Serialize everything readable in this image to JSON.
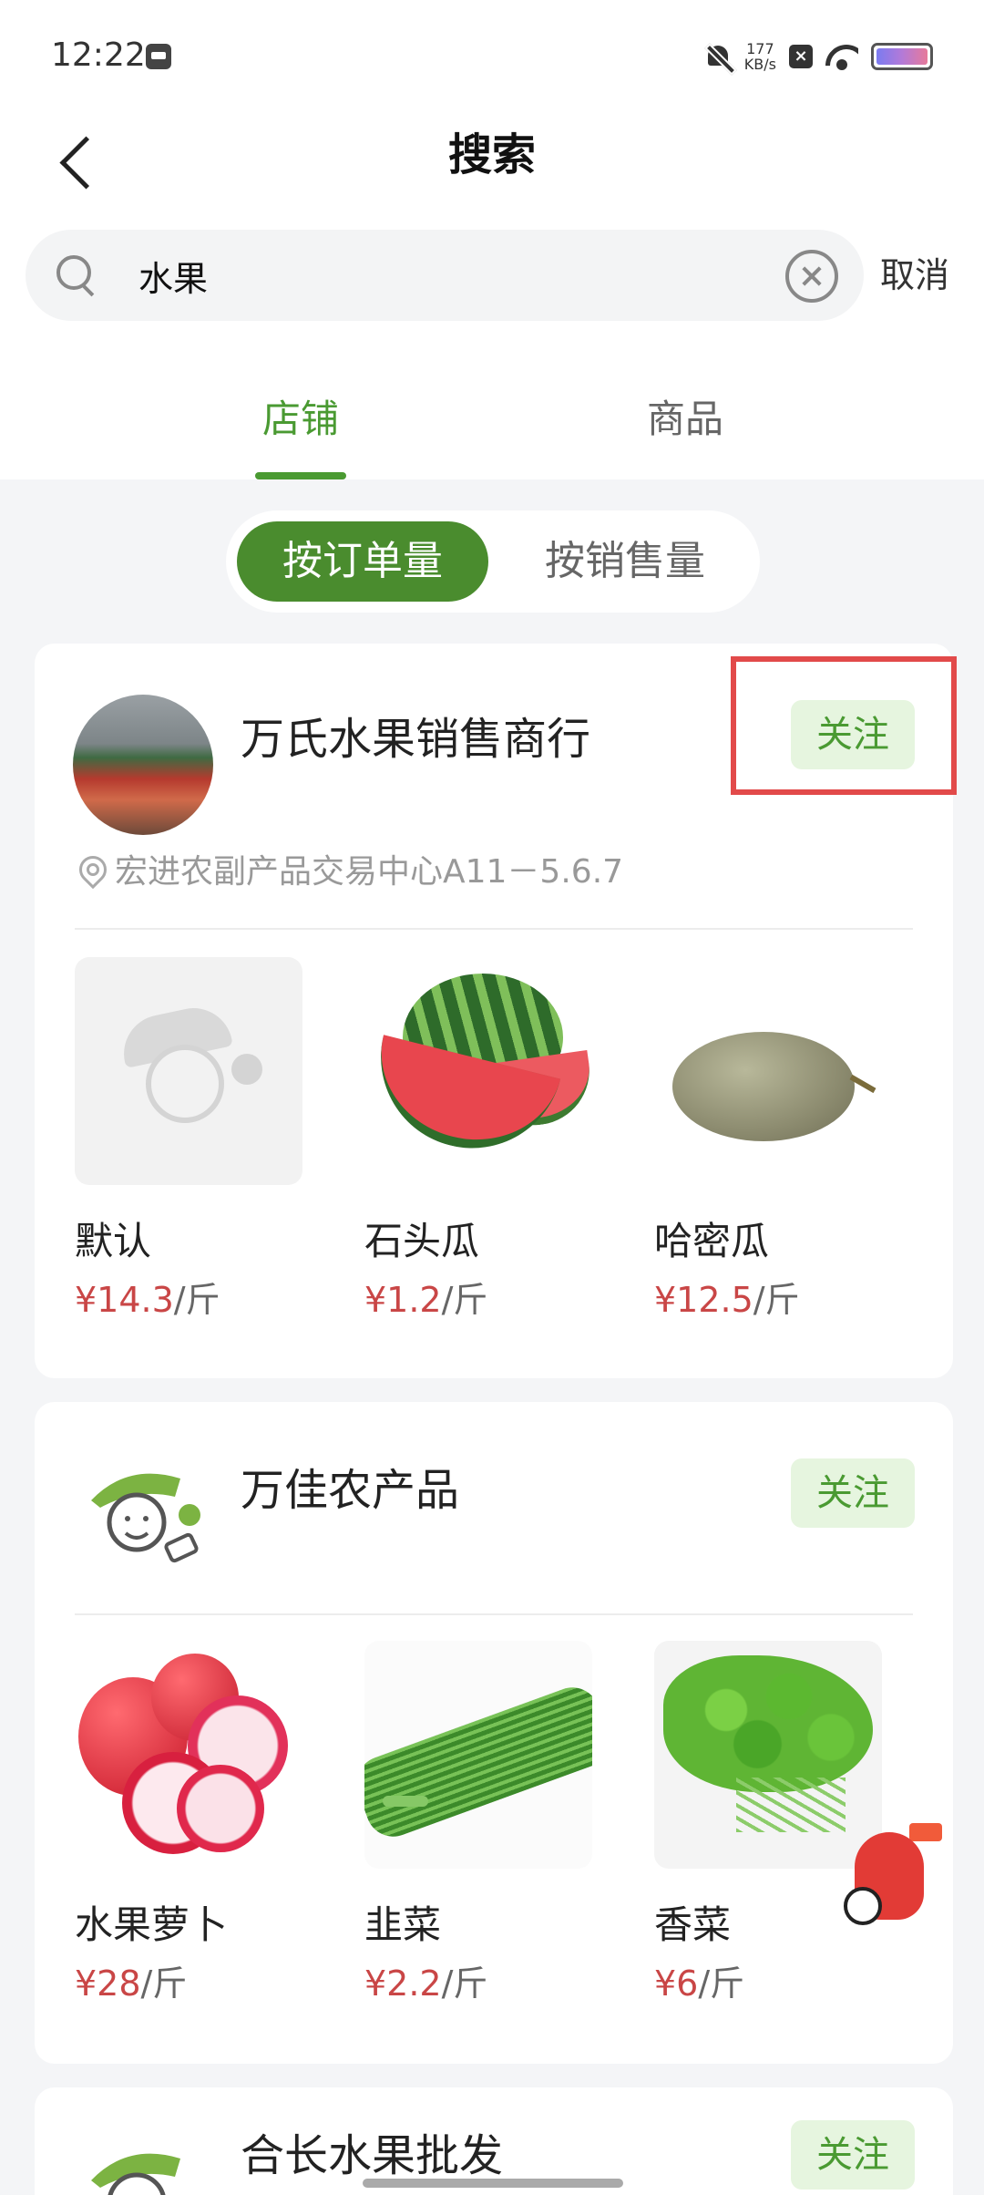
{
  "status_bar": {
    "time": "12:22",
    "net_speed_value": "177",
    "net_speed_unit": "KB/s"
  },
  "header": {
    "title": "搜索"
  },
  "search": {
    "query": "水果",
    "placeholder": "",
    "cancel_label": "取消"
  },
  "tabs": [
    {
      "label": "店铺",
      "active": true
    },
    {
      "label": "商品",
      "active": false
    }
  ],
  "sort": {
    "options": [
      {
        "label": "按订单量",
        "active": true
      },
      {
        "label": "按销售量",
        "active": false
      }
    ]
  },
  "colors": {
    "accent": "#4a9a32",
    "price": "#c94646",
    "highlight_box": "#e24a4a"
  },
  "stores": [
    {
      "name": "万氏水果销售商行",
      "follow_label": "关注",
      "address": "宏进农副产品交易中心A11－5.6.7",
      "products": [
        {
          "name": "默认",
          "price": "¥14.3",
          "unit": "/斤"
        },
        {
          "name": "石头瓜",
          "price": "¥1.2",
          "unit": "/斤"
        },
        {
          "name": "哈密瓜",
          "price": "¥12.5",
          "unit": "/斤"
        }
      ]
    },
    {
      "name": "万佳农产品",
      "follow_label": "关注",
      "products": [
        {
          "name": "水果萝卜",
          "price": "¥28",
          "unit": "/斤"
        },
        {
          "name": "韭菜",
          "price": "¥2.2",
          "unit": "/斤"
        },
        {
          "name": "香菜",
          "price": "¥6",
          "unit": "/斤"
        }
      ]
    },
    {
      "name": "合长水果批发",
      "follow_label": "关注"
    }
  ]
}
